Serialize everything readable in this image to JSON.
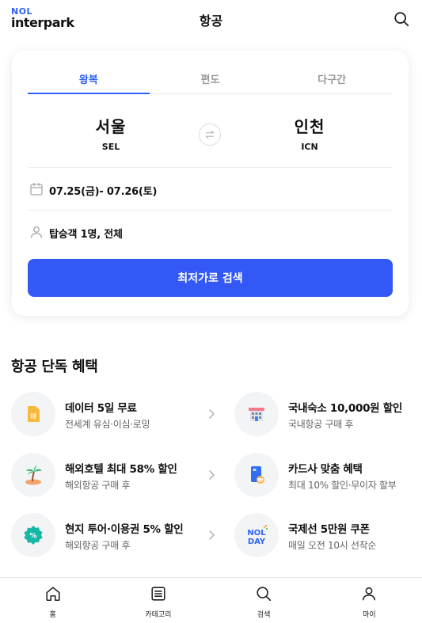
{
  "header": {
    "logo_top": "NOL",
    "logo_word": "interpark",
    "title": "항공",
    "search_icon": "search-icon"
  },
  "search_card": {
    "tabs": [
      {
        "label": "왕복",
        "active": true
      },
      {
        "label": "편도",
        "active": false
      },
      {
        "label": "다구간",
        "active": false
      }
    ],
    "origin": {
      "name": "서울",
      "code": "SEL"
    },
    "destination": {
      "name": "인천",
      "code": "ICN"
    },
    "swap_icon": "swap-arrows-icon",
    "dates": "07.25(금)- 07.26(토)",
    "date_icon": "calendar-icon",
    "passengers": "탑승객 1명, 전체",
    "passenger_icon": "person-icon",
    "search_button": "최저가로 검색"
  },
  "benefits": {
    "title": "항공 단독 혜택",
    "items": [
      {
        "title": "데이터 5일 무료",
        "subtitle": "전세계 유심·이심·로밍",
        "icon": "sim-card-icon"
      },
      {
        "title": "국내숙소 10,000원 할인",
        "subtitle": "국내항공 구매 후",
        "icon": "hotel-building-icon"
      },
      {
        "title": "해외호텔 최대 58% 할인",
        "subtitle": "해외항공 구매 후",
        "icon": "palm-tree-island-icon"
      },
      {
        "title": "카드사 맞춤 혜택",
        "subtitle": "최대 10% 할인·무이자 할부",
        "icon": "credit-card-coin-icon"
      },
      {
        "title": "현지 투어·이용권 5% 할인",
        "subtitle": "해외항공 구매 후",
        "icon": "discount-badge-icon"
      },
      {
        "title": "국제선 5만원 쿠폰",
        "subtitle": "매일 오전 10시 선착순",
        "icon": "nol-day-logo-icon",
        "logo_line1": "NOL",
        "logo_line2": "DAY"
      }
    ]
  },
  "bottom_nav": [
    {
      "label": "홈",
      "icon": "home-icon"
    },
    {
      "label": "카테고리",
      "icon": "category-list-icon"
    },
    {
      "label": "검색",
      "icon": "search-icon"
    },
    {
      "label": "마이",
      "icon": "profile-icon"
    }
  ],
  "colors": {
    "accent": "#2f62f5",
    "button": "#3458f5",
    "muted_text": "#666666"
  }
}
